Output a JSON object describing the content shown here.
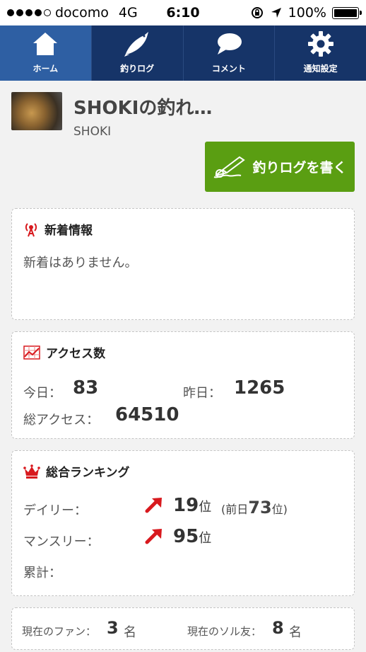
{
  "status_bar": {
    "carrier": "docomo",
    "network": "4G",
    "time": "6:10",
    "battery": "100%",
    "signal_bars": 4
  },
  "nav": {
    "items": [
      {
        "label": "ホーム",
        "icon": "home-icon"
      },
      {
        "label": "釣りログ",
        "icon": "fish-icon"
      },
      {
        "label": "コメント",
        "icon": "speech-bubble-icon"
      },
      {
        "label": "通知設定",
        "icon": "gear-icon"
      }
    ],
    "active": "ホーム"
  },
  "profile": {
    "title": "SHOKIの釣れ…",
    "username": "SHOKI"
  },
  "write_button": {
    "label": "釣りログを書く",
    "icon": "pen-icon"
  },
  "news": {
    "title": "新着情報",
    "icon": "antenna-icon",
    "message": "新着はありません。"
  },
  "access": {
    "title": "アクセス数",
    "icon": "chart-icon",
    "today_label": "今日：",
    "today_value": "83",
    "yesterday_label": "昨日：",
    "yesterday_value": "1265",
    "total_label": "総アクセス：",
    "total_value": "64510"
  },
  "ranking": {
    "title": "総合ランキング",
    "icon": "crown-icon",
    "daily_label": "デイリー：",
    "daily_value": "19",
    "daily_unit": "位",
    "daily_prev_prefix": "(前日",
    "daily_prev_value": "73",
    "daily_prev_suffix": "位)",
    "monthly_label": "マンスリー：",
    "monthly_value": "95",
    "monthly_unit": "位",
    "total_label": "累計："
  },
  "fans": {
    "fan_label": "現在のファン：",
    "fan_value": "3",
    "fan_unit": "名",
    "friend_label": "現在のソル友：",
    "friend_value": "8",
    "friend_unit": "名"
  },
  "colors": {
    "nav_bg": "#163468",
    "nav_active": "#2e5fa3",
    "write_button": "#5a9e12",
    "accent_red": "#d8191e"
  }
}
